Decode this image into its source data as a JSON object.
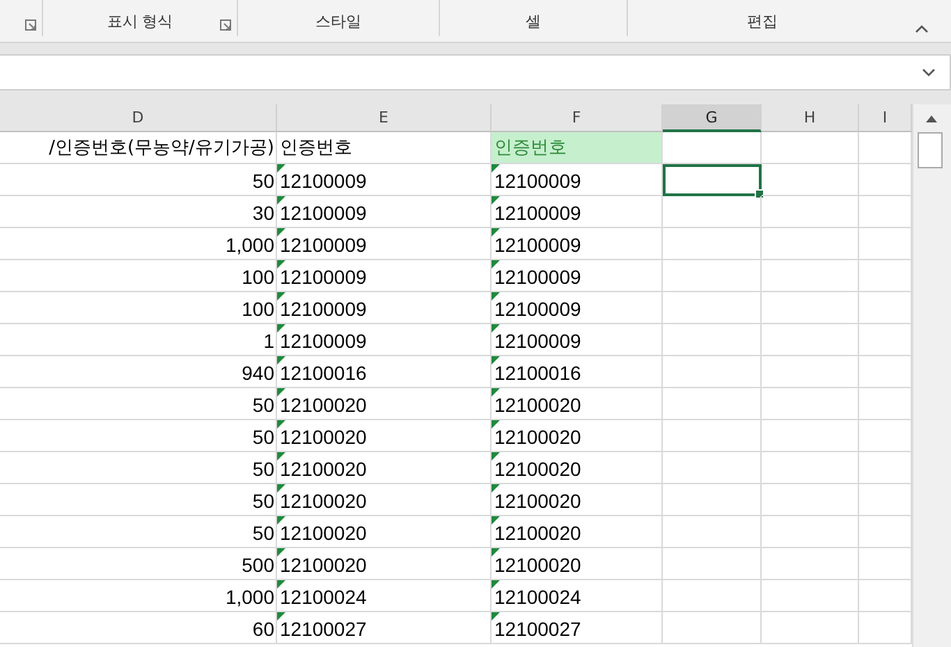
{
  "ribbon": {
    "groups": [
      {
        "launcher": true
      },
      {
        "label": "표시 형식",
        "launcher": true
      },
      {
        "label": "스타일",
        "launcher": false
      },
      {
        "label": "셀",
        "launcher": false
      },
      {
        "label": "편집",
        "launcher": false
      }
    ]
  },
  "columns": [
    {
      "label": "D",
      "selected": false
    },
    {
      "label": "E",
      "selected": false
    },
    {
      "label": "F",
      "selected": false
    },
    {
      "label": "G",
      "selected": true
    },
    {
      "label": "H",
      "selected": false
    },
    {
      "label": "I",
      "selected": false
    }
  ],
  "header_row": {
    "d": "/인증번호(무농약/유기가공)",
    "e": "인증번호",
    "f": "인증번호",
    "f_highlighted": true
  },
  "rows": [
    {
      "d": "50",
      "e": "12100009",
      "f": "12100009",
      "e_flagged": true,
      "f_flagged": true,
      "g_selected": true
    },
    {
      "d": "30",
      "e": "12100009",
      "f": "12100009",
      "e_flagged": true,
      "f_flagged": true,
      "g_selected": false
    },
    {
      "d": "1,000",
      "e": "12100009",
      "f": "12100009",
      "e_flagged": true,
      "f_flagged": true,
      "g_selected": false
    },
    {
      "d": "100",
      "e": "12100009",
      "f": "12100009",
      "e_flagged": true,
      "f_flagged": true,
      "g_selected": false
    },
    {
      "d": "100",
      "e": "12100009",
      "f": "12100009",
      "e_flagged": true,
      "f_flagged": true,
      "g_selected": false
    },
    {
      "d": "1",
      "e": "12100009",
      "f": "12100009",
      "e_flagged": true,
      "f_flagged": true,
      "g_selected": false
    },
    {
      "d": "940",
      "e": "12100016",
      "f": "12100016",
      "e_flagged": true,
      "f_flagged": true,
      "g_selected": false
    },
    {
      "d": "50",
      "e": "12100020",
      "f": "12100020",
      "e_flagged": true,
      "f_flagged": true,
      "g_selected": false
    },
    {
      "d": "50",
      "e": "12100020",
      "f": "12100020",
      "e_flagged": true,
      "f_flagged": true,
      "g_selected": false
    },
    {
      "d": "50",
      "e": "12100020",
      "f": "12100020",
      "e_flagged": true,
      "f_flagged": true,
      "g_selected": false
    },
    {
      "d": "50",
      "e": "12100020",
      "f": "12100020",
      "e_flagged": true,
      "f_flagged": true,
      "g_selected": false
    },
    {
      "d": "50",
      "e": "12100020",
      "f": "12100020",
      "e_flagged": true,
      "f_flagged": true,
      "g_selected": false
    },
    {
      "d": "500",
      "e": "12100020",
      "f": "12100020",
      "e_flagged": true,
      "f_flagged": true,
      "g_selected": false
    },
    {
      "d": "1,000",
      "e": "12100024",
      "f": "12100024",
      "e_flagged": true,
      "f_flagged": true,
      "g_selected": false
    },
    {
      "d": "60",
      "e": "12100027",
      "f": "12100027",
      "e_flagged": true,
      "f_flagged": true,
      "g_selected": false
    }
  ]
}
